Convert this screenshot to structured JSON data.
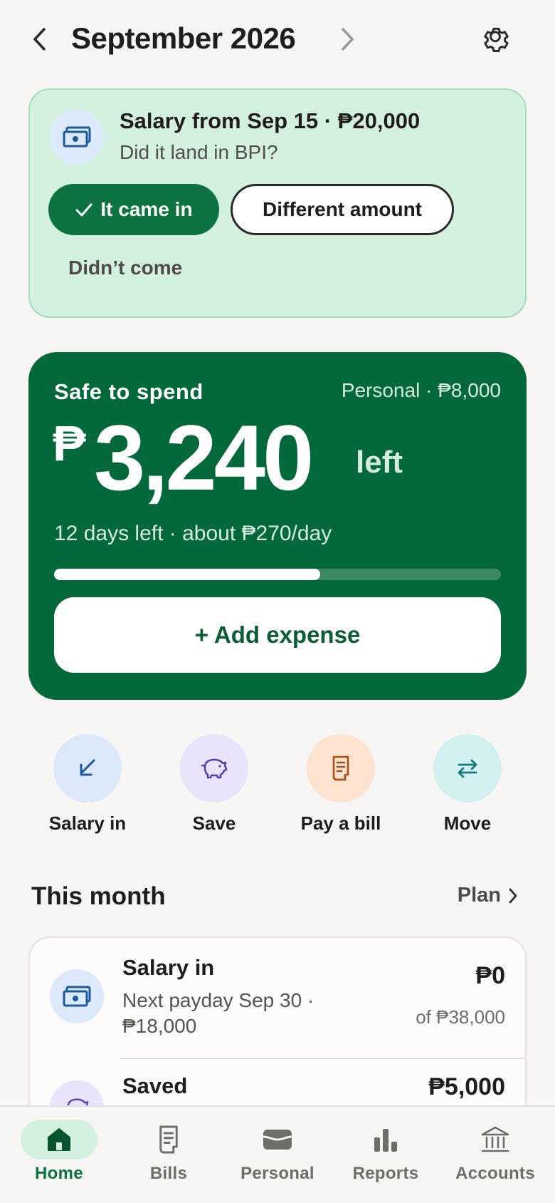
{
  "header": {
    "title": "September 2026",
    "prev_icon": "chevron-left-icon",
    "next_icon": "chevron-right-icon",
    "settings_icon": "gear-icon"
  },
  "salary_prompt": {
    "title": "Salary from Sep 15 · ₱20,000",
    "subtitle": "Did it land in BPI?",
    "icon": "cash-icon",
    "came_in_label": "It came in",
    "different_label": "Different amount",
    "didnt_label": "Didn’t come"
  },
  "safe_to_spend": {
    "label": "Safe to spend",
    "account": "Personal · ₱8,000",
    "currency": "₱",
    "amount": "3,240",
    "suffix": "left",
    "days_info": "12 days left · about ₱270/day",
    "progress_fraction": 0.595,
    "add_expense_label": "+ Add expense"
  },
  "quick_actions": [
    {
      "label": "Salary in",
      "icon": "arrow-down-left-icon",
      "bg": "#dbe9fb"
    },
    {
      "label": "Save",
      "icon": "piggy-bank-icon",
      "bg": "#e9e3fb"
    },
    {
      "label": "Pay a bill",
      "icon": "receipt-icon",
      "bg": "#fde3d0"
    },
    {
      "label": "Move",
      "icon": "transfer-arrows-icon",
      "bg": "#d3f1f1"
    }
  ],
  "this_month": {
    "title": "This month",
    "plan_label": "Plan",
    "rows": [
      {
        "title": "Salary in",
        "subtitle": "Next payday Sep 30 · ₱18,000",
        "amount": "₱0",
        "of": "of ₱38,000"
      },
      {
        "title": "Saved",
        "amount": "₱5,000"
      }
    ]
  },
  "bottom_nav": [
    {
      "label": "Home",
      "icon": "home-icon",
      "active": true
    },
    {
      "label": "Bills",
      "icon": "receipt-icon"
    },
    {
      "label": "Personal",
      "icon": "wallet-icon"
    },
    {
      "label": "Reports",
      "icon": "bar-chart-icon"
    },
    {
      "label": "Accounts",
      "icon": "bank-icon"
    }
  ],
  "colors": {
    "brand_green": "#03683a",
    "accent_green": "#0b7240",
    "prompt_bg": "#d4f1df",
    "page_bg": "#f8f6f4"
  }
}
